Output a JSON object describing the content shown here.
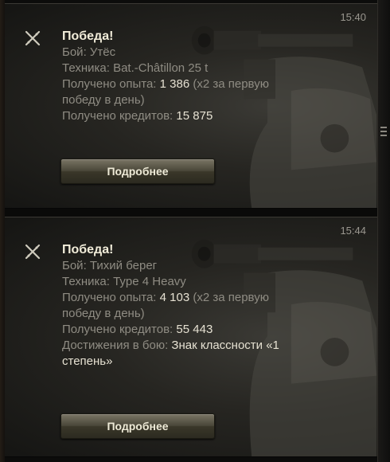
{
  "notifications": [
    {
      "time": "15:40",
      "title": "Победа!",
      "battle_label": "Бой:",
      "battle_value": "Утёс",
      "vehicle_label": "Техника:",
      "vehicle_value": "Bat.-Châtillon 25 t",
      "xp_label": "Получено опыта:",
      "xp_value": "1 386",
      "xp_bonus_1": "(x2 за первую",
      "xp_bonus_2": "победу в день)",
      "credits_label": "Получено кредитов:",
      "credits_value": "15 875",
      "button_label": "Подробнее",
      "icon": "crossed-swords-icon"
    },
    {
      "time": "15:44",
      "title": "Победа!",
      "battle_label": "Бой:",
      "battle_value": "Тихий берег",
      "vehicle_label": "Техника:",
      "vehicle_value": "Type 4 Heavy",
      "xp_label": "Получено опыта:",
      "xp_value": "4 103",
      "xp_bonus_1": "(x2 за первую",
      "xp_bonus_2": "победу в день)",
      "credits_label": "Получено кредитов:",
      "credits_value": "55 443",
      "achievements_label": "Достижения в бою:",
      "achievements_value_1": "Знак классности «1",
      "achievements_value_2": "степень»",
      "button_label": "Подробнее",
      "icon": "crossed-swords-icon"
    }
  ],
  "colors": {
    "title": "#f1ecd9",
    "label": "#8f8c83",
    "value": "#e6e1d2",
    "button": "#4a4739"
  }
}
